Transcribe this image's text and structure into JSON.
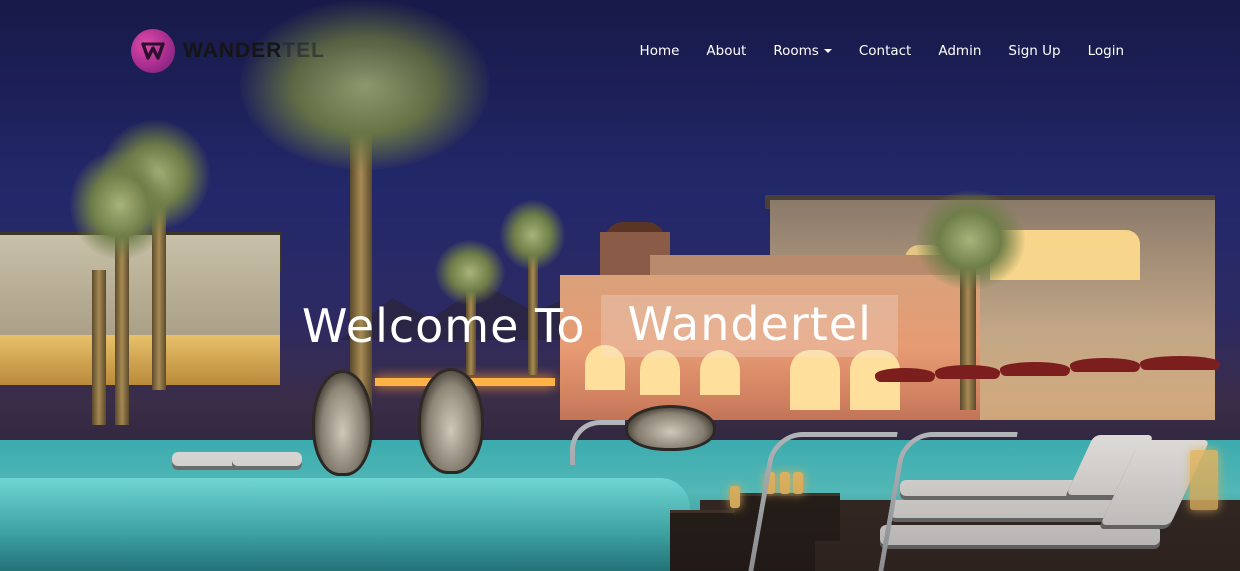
{
  "brand": {
    "name_part1": "WANDER",
    "name_part2": "TEL",
    "logo_icon": "w-monogram-icon",
    "logo_colors": [
      "#e04aa8",
      "#6b1e79"
    ]
  },
  "nav": {
    "home": "Home",
    "about": "About",
    "rooms": "Rooms",
    "contact": "Contact",
    "admin": "Admin",
    "signup": "Sign Up",
    "login": "Login",
    "rooms_dropdown_icon": "caret-down-icon"
  },
  "hero": {
    "headline_prefix": "Welcome To",
    "headline_highlight": "Wandertel",
    "background": "resort pool at night"
  }
}
